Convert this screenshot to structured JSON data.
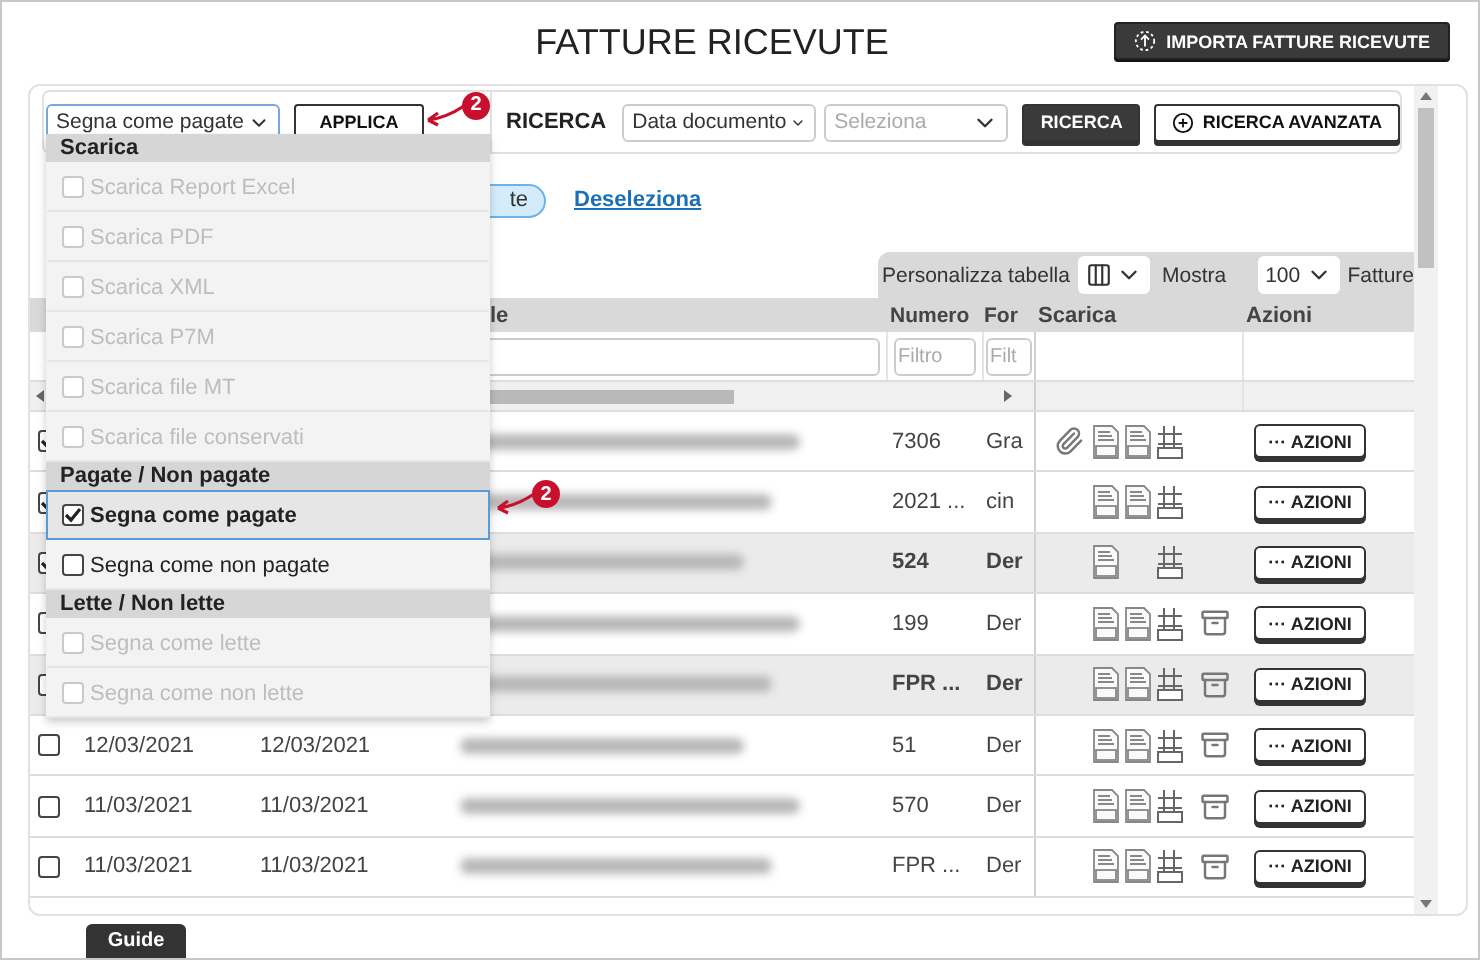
{
  "title": "FATTURE RICEVUTE",
  "import_button": "IMPORTA FATTURE RICEVUTE",
  "toolbar": {
    "action_select": "Segna come pagate",
    "apply_button": "APPLICA",
    "search_label": "RICERCA",
    "search_field_select": "Data documento",
    "value_select_placeholder": "Seleziona",
    "search_button": "RICERCA",
    "advanced_button": "RICERCA AVANZATA"
  },
  "annotations": [
    {
      "label": "2"
    },
    {
      "label": "2"
    }
  ],
  "selection_bar": {
    "pill": "te",
    "deselect_link": "Deseleziona"
  },
  "table_toolbar": {
    "customize_label": "Personalizza tabella",
    "show_label": "Mostra",
    "page_size": "100",
    "unit_label": "Fatture"
  },
  "table": {
    "headers": {
      "column_4": "le",
      "numero": "Numero",
      "column_6": "For",
      "scarica": "Scarica",
      "azioni": "Azioni"
    },
    "filters": {
      "numero": {
        "placeholder": "Filtro"
      },
      "column_6": {
        "placeholder": "Filt"
      }
    },
    "rows": [
      {
        "checked": true,
        "unread": false,
        "numero": "7306",
        "column_6": "Gra",
        "attachment": true,
        "pdf": true,
        "sdi": true,
        "xml": true,
        "archived": false,
        "action": "··· AZIONI"
      },
      {
        "checked": true,
        "unread": false,
        "numero": "2021 ...",
        "column_6": "cin",
        "pdf": true,
        "sdi": true,
        "xml": true,
        "archived": false,
        "action": "··· AZIONI"
      },
      {
        "checked": true,
        "unread": true,
        "numero": "524",
        "column_6": "Der",
        "pdf": true,
        "sdi": false,
        "xml": true,
        "archived": false,
        "action": "··· AZIONI"
      },
      {
        "checked": false,
        "unread": false,
        "numero": "199",
        "column_6": "Der",
        "pdf": true,
        "sdi": true,
        "xml": true,
        "archived": true,
        "action": "··· AZIONI"
      },
      {
        "checked": false,
        "unread": true,
        "numero": "FPR ...",
        "column_6": "Der",
        "pdf": true,
        "sdi": true,
        "xml": true,
        "archived": true,
        "action": "··· AZIONI"
      },
      {
        "checked": false,
        "unread": false,
        "date_1": "12/03/2021",
        "date_2": "12/03/2021",
        "numero": "51",
        "column_6": "Der",
        "pdf": true,
        "sdi": true,
        "xml": true,
        "archived": true,
        "action": "··· AZIONI"
      },
      {
        "checked": false,
        "unread": false,
        "date_1": "11/03/2021",
        "date_2": "11/03/2021",
        "numero": "570",
        "column_6": "Der",
        "pdf": true,
        "sdi": true,
        "xml": true,
        "archived": true,
        "action": "··· AZIONI"
      },
      {
        "checked": false,
        "unread": false,
        "date_1": "11/03/2021",
        "date_2": "11/03/2021",
        "numero": "FPR ...",
        "column_6": "Der",
        "pdf": true,
        "sdi": true,
        "xml": true,
        "archived": true,
        "action": "··· AZIONI"
      }
    ]
  },
  "menu": {
    "groups": [
      {
        "title": "Scarica",
        "items": [
          {
            "label": "Scarica Report Excel",
            "disabled": true,
            "checked": false,
            "selected": false
          },
          {
            "label": "Scarica PDF",
            "disabled": true,
            "checked": false,
            "selected": false
          },
          {
            "label": "Scarica XML",
            "disabled": true,
            "checked": false,
            "selected": false
          },
          {
            "label": "Scarica P7M",
            "disabled": true,
            "checked": false,
            "selected": false
          },
          {
            "label": "Scarica file MT",
            "disabled": true,
            "checked": false,
            "selected": false
          },
          {
            "label": "Scarica file conservati",
            "disabled": true,
            "checked": false,
            "selected": false
          }
        ]
      },
      {
        "title": "Pagate / Non pagate",
        "items": [
          {
            "label": "Segna come pagate",
            "disabled": false,
            "checked": true,
            "selected": true
          },
          {
            "label": "Segna come non pagate",
            "disabled": false,
            "checked": false,
            "selected": false
          }
        ]
      },
      {
        "title": "Lette / Non lette",
        "items": [
          {
            "label": "Segna come lette",
            "disabled": true,
            "checked": false,
            "selected": false
          },
          {
            "label": "Segna come non lette",
            "disabled": true,
            "checked": false,
            "selected": false
          }
        ]
      }
    ]
  },
  "guide_tab": "Guide"
}
